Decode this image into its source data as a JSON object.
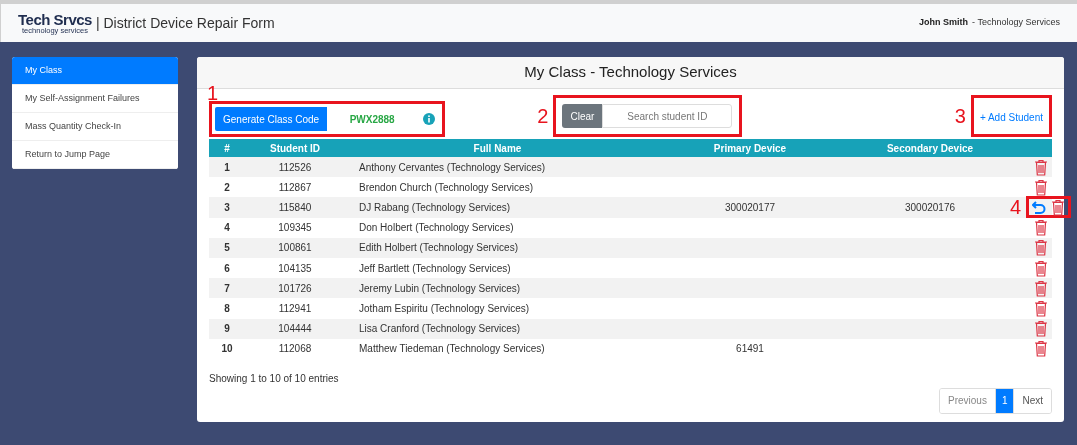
{
  "header": {
    "logo_main": "Tech Srvcs",
    "logo_sub": "technology services",
    "title": "| District Device Repair Form",
    "user_name": "John Smith",
    "user_dept": "- Technology Services"
  },
  "sidebar": {
    "items": [
      {
        "label": "My Class",
        "selected": true
      },
      {
        "label": "My Self-Assignment Failures",
        "selected": false
      },
      {
        "label": "Mass Quantity Check-In",
        "selected": false
      },
      {
        "label": "Return to Jump Page",
        "selected": false
      }
    ]
  },
  "card": {
    "title": "My Class - Technology Services",
    "class_code": {
      "callout": "1",
      "button": "Generate Class Code",
      "code": "PWX2888"
    },
    "search": {
      "callout": "2",
      "clear": "Clear",
      "placeholder": "Search student ID"
    },
    "add_student": {
      "callout": "3",
      "label": "+ Add Student"
    },
    "table": {
      "columns": [
        "#",
        "Student ID",
        "Full Name",
        "Primary Device",
        "Secondary Device"
      ],
      "rows": [
        {
          "cells": [
            "1",
            "112526",
            "Anthony Cervantes (Technology Services)",
            "",
            ""
          ],
          "undo": false
        },
        {
          "cells": [
            "2",
            "112867",
            "Brendon Church (Technology Services)",
            "",
            ""
          ],
          "undo": false
        },
        {
          "cells": [
            "3",
            "115840",
            "DJ Rabang (Technology Services)",
            "300020177",
            "300020176"
          ],
          "undo": true,
          "callout": "4"
        },
        {
          "cells": [
            "4",
            "109345",
            "Don Holbert (Technology Services)",
            "",
            ""
          ],
          "undo": false
        },
        {
          "cells": [
            "5",
            "100861",
            "Edith Holbert (Technology Services)",
            "",
            ""
          ],
          "undo": false
        },
        {
          "cells": [
            "6",
            "104135",
            "Jeff Bartlett (Technology Services)",
            "",
            ""
          ],
          "undo": false
        },
        {
          "cells": [
            "7",
            "101726",
            "Jeremy Lubin (Technology Services)",
            "",
            ""
          ],
          "undo": false
        },
        {
          "cells": [
            "8",
            "112941",
            "Jotham Espiritu (Technology Services)",
            "",
            ""
          ],
          "undo": false
        },
        {
          "cells": [
            "9",
            "104444",
            "Lisa Cranford (Technology Services)",
            "",
            ""
          ],
          "undo": false
        },
        {
          "cells": [
            "10",
            "112068",
            "Matthew Tiedeman (Technology Services)",
            "61491",
            ""
          ],
          "undo": false
        }
      ]
    },
    "entries_info": "Showing 1 to 10 of 10 entries",
    "pagination": [
      {
        "label": "Previous",
        "kind": "nav",
        "disabled": true,
        "selected": false
      },
      {
        "label": "1",
        "kind": "page",
        "disabled": false,
        "selected": true
      },
      {
        "label": "Next",
        "kind": "nav",
        "disabled": false,
        "selected": false
      }
    ]
  }
}
